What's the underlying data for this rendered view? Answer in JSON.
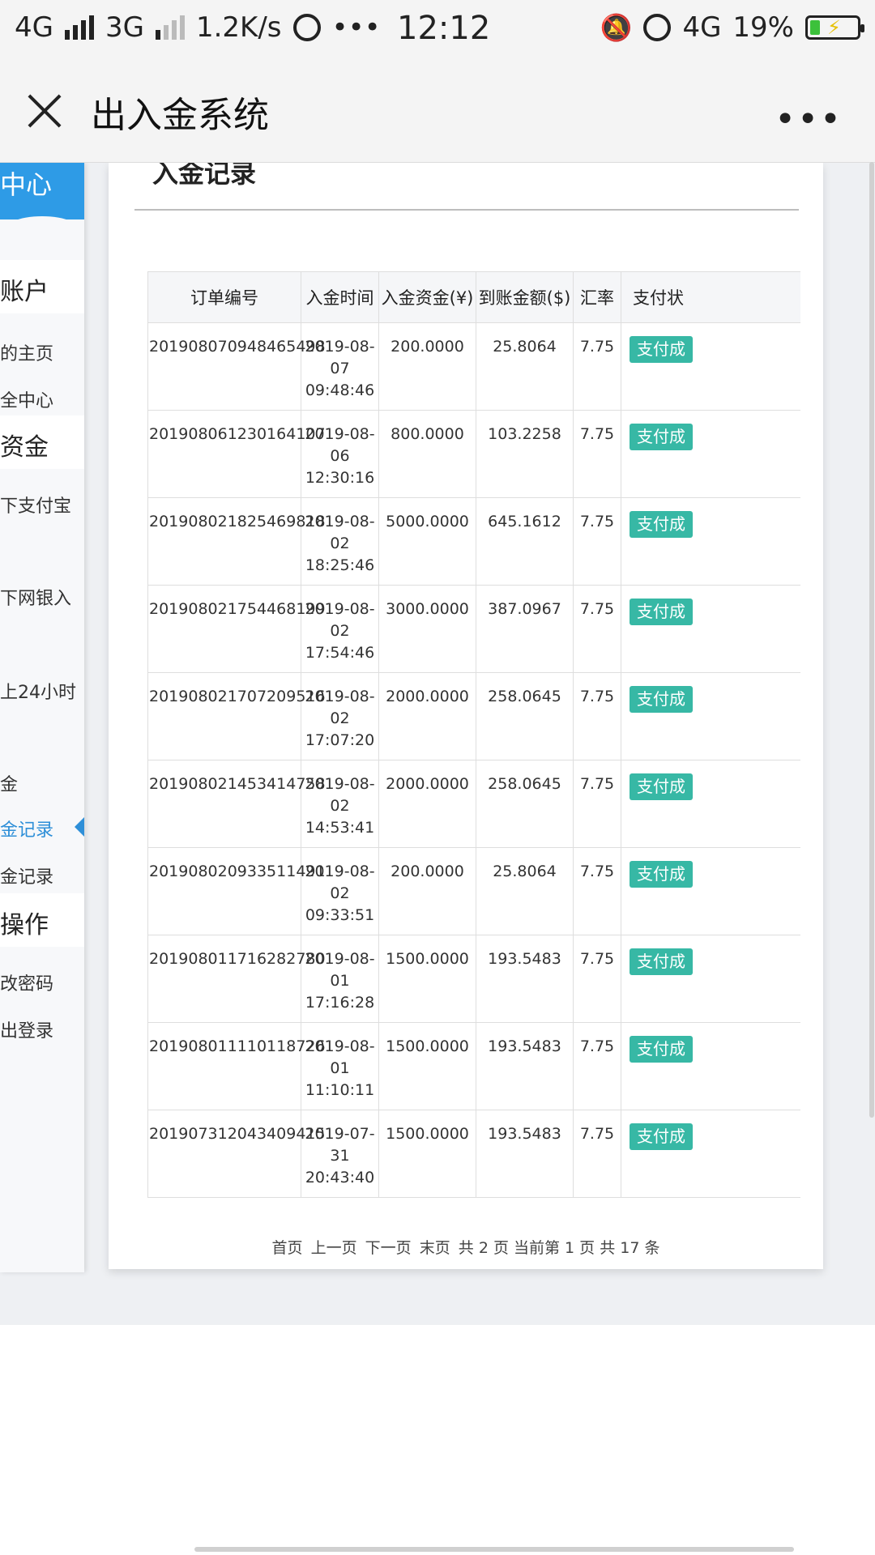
{
  "status_bar": {
    "net1": "4G",
    "net2": "3G",
    "speed": "1.2K/s",
    "dots": "•••",
    "time": "12:12",
    "net3": "4G",
    "battery": "19%"
  },
  "header": {
    "title": "出入金系统",
    "more": "•••"
  },
  "sidebar": {
    "top_label": "中心",
    "sections": [
      {
        "label": "账户"
      },
      {
        "label": "资金"
      },
      {
        "label": "操作"
      }
    ],
    "items": [
      {
        "label": "的主页"
      },
      {
        "label": "全中心"
      },
      {
        "label": "下支付宝"
      },
      {
        "label": "下网银入"
      },
      {
        "label": "上24小时"
      },
      {
        "label": "金"
      },
      {
        "label": "金记录"
      },
      {
        "label": "金记录"
      },
      {
        "label": "改密码"
      },
      {
        "label": "出登录"
      }
    ]
  },
  "card": {
    "title": "入金记录"
  },
  "table": {
    "headers": [
      "订单编号",
      "入金时间",
      "入金资金(¥)",
      "到账金额($)",
      "汇率",
      "支付状"
    ],
    "rows": [
      {
        "order": "201908070948465498",
        "date": "2019-08-",
        "day": "07",
        "time": "09:48:46",
        "amount": "200.0000",
        "received": "25.8064",
        "rate": "7.75",
        "status": "支付成"
      },
      {
        "order": "201908061230164107",
        "date": "2019-08-",
        "day": "06",
        "time": "12:30:16",
        "amount": "800.0000",
        "received": "103.2258",
        "rate": "7.75",
        "status": "支付成"
      },
      {
        "order": "201908021825469818",
        "date": "2019-08-",
        "day": "02",
        "time": "18:25:46",
        "amount": "5000.0000",
        "received": "645.1612",
        "rate": "7.75",
        "status": "支付成"
      },
      {
        "order": "201908021754468199",
        "date": "2019-08-",
        "day": "02",
        "time": "17:54:46",
        "amount": "3000.0000",
        "received": "387.0967",
        "rate": "7.75",
        "status": "支付成"
      },
      {
        "order": "201908021707209516",
        "date": "2019-08-",
        "day": "02",
        "time": "17:07:20",
        "amount": "2000.0000",
        "received": "258.0645",
        "rate": "7.75",
        "status": "支付成"
      },
      {
        "order": "201908021453414758",
        "date": "2019-08-",
        "day": "02",
        "time": "14:53:41",
        "amount": "2000.0000",
        "received": "258.0645",
        "rate": "7.75",
        "status": "支付成"
      },
      {
        "order": "201908020933511491",
        "date": "2019-08-",
        "day": "02",
        "time": "09:33:51",
        "amount": "200.0000",
        "received": "25.8064",
        "rate": "7.75",
        "status": "支付成"
      },
      {
        "order": "201908011716282780",
        "date": "2019-08-",
        "day": "01",
        "time": "17:16:28",
        "amount": "1500.0000",
        "received": "193.5483",
        "rate": "7.75",
        "status": "支付成"
      },
      {
        "order": "201908011110118726",
        "date": "2019-08-",
        "day": "01",
        "time": "11:10:11",
        "amount": "1500.0000",
        "received": "193.5483",
        "rate": "7.75",
        "status": "支付成"
      },
      {
        "order": "201907312043409415",
        "date": "2019-07-",
        "day": "31",
        "time": "20:43:40",
        "amount": "1500.0000",
        "received": "193.5483",
        "rate": "7.75",
        "status": "支付成"
      }
    ]
  },
  "pager": {
    "first": "首页",
    "prev": "上一页",
    "next": "下一页",
    "last": "末页",
    "summary": "共 2 页 当前第 1 页 共 17 条"
  },
  "colors": {
    "accent": "#2e9be6",
    "badge": "#37b8a5"
  }
}
